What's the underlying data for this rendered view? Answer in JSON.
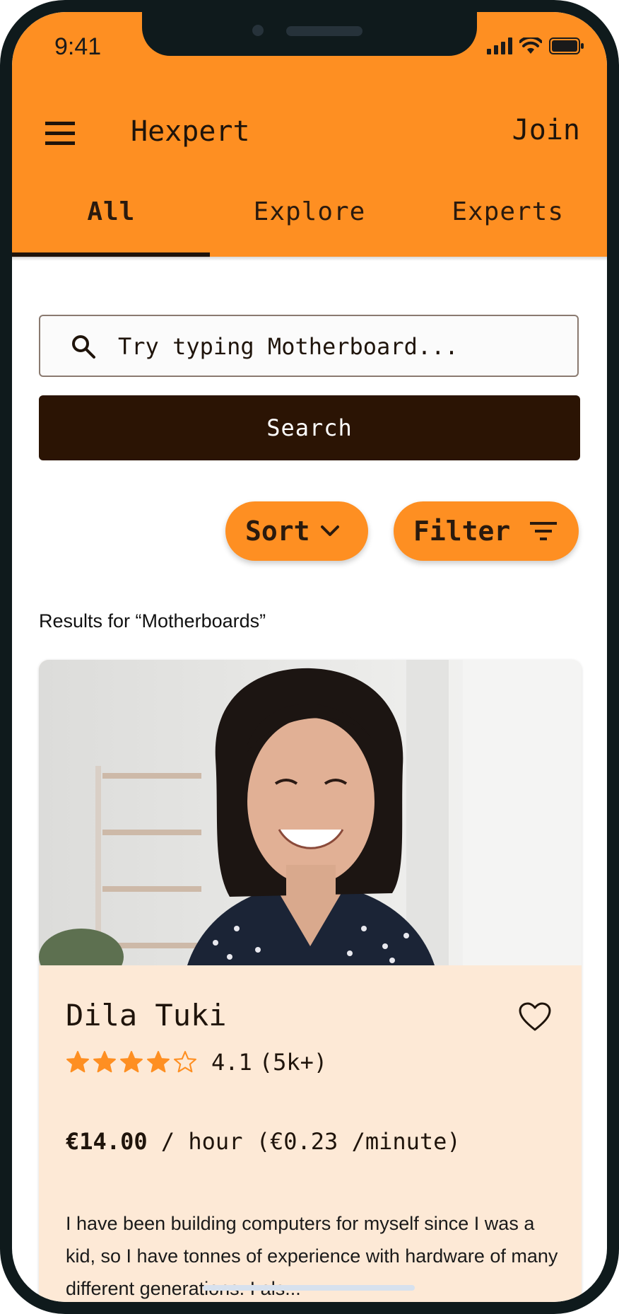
{
  "status": {
    "time": "9:41"
  },
  "header": {
    "title": "Hexpert",
    "join_label": "Join"
  },
  "tabs": [
    {
      "label": "All",
      "active": true
    },
    {
      "label": "Explore",
      "active": false
    },
    {
      "label": "Experts",
      "active": false
    }
  ],
  "search": {
    "placeholder": "Try typing Motherboard...",
    "value": "",
    "button_label": "Search"
  },
  "controls": {
    "sort_label": "Sort",
    "filter_label": "Filter"
  },
  "results_label": "Results for “Motherboards”",
  "expert": {
    "name": "Dila Tuki",
    "rating": 4.1,
    "rating_value": "4.1",
    "rating_count": "(5k+)",
    "price": "€14.00",
    "price_unit": "/ hour",
    "price_minute": "(€0.23",
    "price_minute_unit": "/minute)",
    "bio": "I have been building computers for myself since I was a kid, so I have tonnes of experience with hardware of many different generations. I als..."
  },
  "colors": {
    "accent": "#fe8f22",
    "dark": "#2b1404",
    "card_bg": "#fde9d6"
  }
}
